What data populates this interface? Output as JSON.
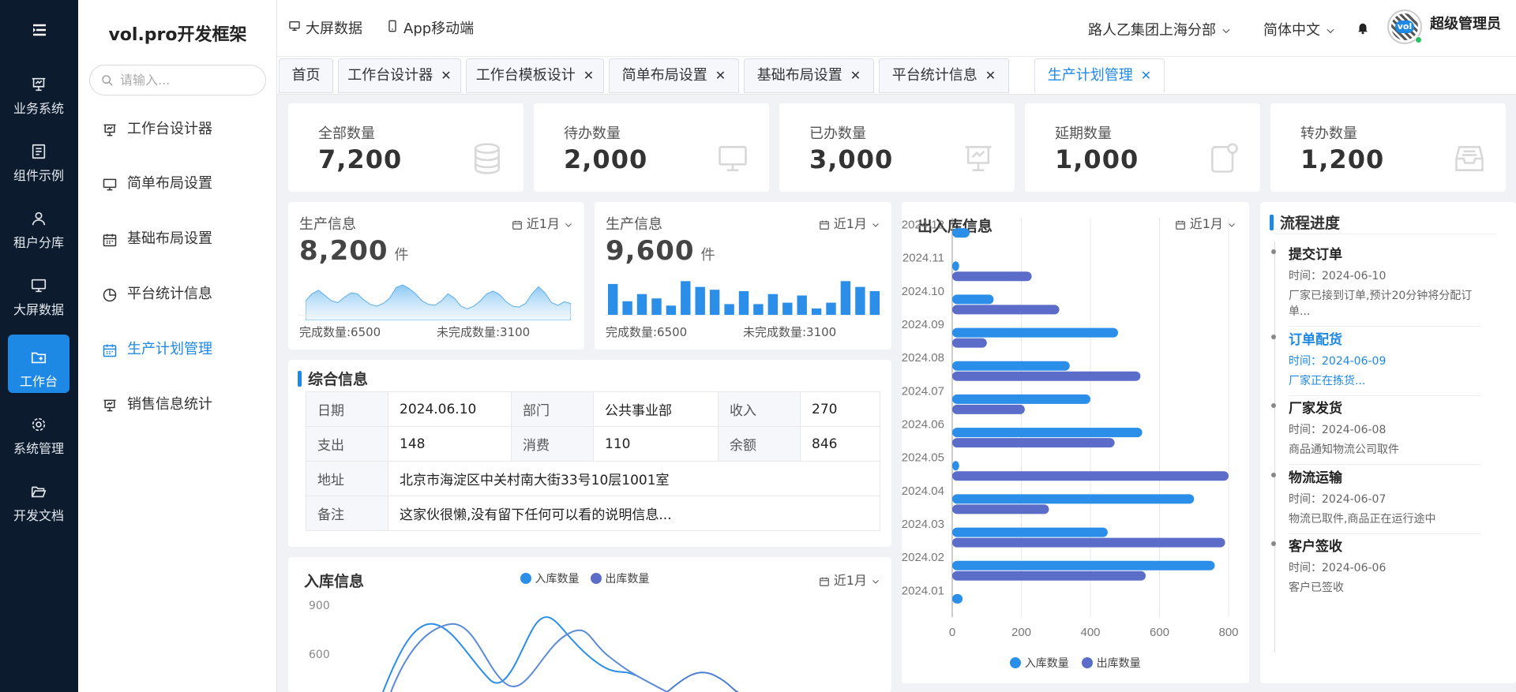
{
  "app": {
    "title": "vol.pro开发框架"
  },
  "rail": {
    "items": [
      {
        "label": "业务系统",
        "icon": "presentation-icon"
      },
      {
        "label": "组件示例",
        "icon": "document-icon"
      },
      {
        "label": "租户分库",
        "icon": "user-icon"
      },
      {
        "label": "大屏数据",
        "icon": "monitor-icon"
      },
      {
        "label": "工作台",
        "icon": "folder-plus-icon",
        "active": true
      },
      {
        "label": "系统管理",
        "icon": "gear-icon"
      },
      {
        "label": "开发文档",
        "icon": "folder-open-icon"
      }
    ]
  },
  "sidebar": {
    "search_placeholder": "请输入...",
    "items": [
      {
        "label": "工作台设计器",
        "icon": "presentation-icon"
      },
      {
        "label": "简单布局设置",
        "icon": "monitor-icon"
      },
      {
        "label": "基础布局设置",
        "icon": "calendar-icon"
      },
      {
        "label": "平台统计信息",
        "icon": "pie-chart-icon"
      },
      {
        "label": "生产计划管理",
        "icon": "calendar-icon",
        "active": true
      },
      {
        "label": "销售信息统计",
        "icon": "presentation-icon"
      }
    ]
  },
  "header": {
    "links": [
      {
        "label": "大屏数据",
        "icon": "monitor-icon"
      },
      {
        "label": "App移动端",
        "icon": "mobile-icon"
      }
    ],
    "org": "路人乙集团上海分部",
    "language": "简体中文",
    "user": "超级管理员",
    "avatar_text": "vol"
  },
  "tabs": [
    {
      "label": "首页"
    },
    {
      "label": "工作台设计器"
    },
    {
      "label": "工作台模板设计"
    },
    {
      "label": "简单布局设置"
    },
    {
      "label": "基础布局设置"
    },
    {
      "label": "平台统计信息"
    },
    {
      "label": "生产计划管理",
      "active": true
    }
  ],
  "close_glyph": "✕",
  "stats": [
    {
      "label": "全部数量",
      "value": "7,200",
      "icon": "database-icon"
    },
    {
      "label": "待办数量",
      "value": "2,000",
      "icon": "monitor-icon"
    },
    {
      "label": "已办数量",
      "value": "3,000",
      "icon": "presentation-icon"
    },
    {
      "label": "延期数量",
      "value": "1,000",
      "icon": "document-badge-icon"
    },
    {
      "label": "转办数量",
      "value": "1,200",
      "icon": "inbox-icon"
    }
  ],
  "production": [
    {
      "title": "生产信息",
      "value": "8,200",
      "unit": "件",
      "range": "近1月",
      "done": "完成数量:6500",
      "undone": "未完成数量:3100",
      "series": [
        22,
        30,
        34,
        28,
        22,
        20,
        26,
        31,
        30,
        23,
        18,
        16,
        19,
        25,
        37,
        40,
        36,
        30,
        22,
        18,
        17,
        22,
        30,
        25,
        16,
        13,
        16,
        22,
        30,
        33,
        29,
        21,
        16,
        15,
        19,
        30,
        38,
        31,
        20,
        17,
        21,
        19
      ]
    },
    {
      "title": "生产信息",
      "value": "9,600",
      "unit": "件",
      "range": "近1月",
      "done": "完成数量:6500",
      "undone": "未完成数量:3100",
      "bars": [
        22,
        10,
        15,
        12,
        7,
        24,
        20,
        18,
        8,
        17,
        8,
        15,
        9,
        14,
        5,
        9,
        24,
        20,
        17
      ]
    }
  ],
  "summary": {
    "title": "综合信息",
    "rows": [
      [
        {
          "k": "日期",
          "v": "2024.06.10"
        },
        {
          "k": "部门",
          "v": "公共事业部"
        },
        {
          "k": "收入",
          "v": "270"
        }
      ],
      [
        {
          "k": "支出",
          "v": "148"
        },
        {
          "k": "消费",
          "v": "110"
        },
        {
          "k": "余额",
          "v": "846"
        }
      ],
      [
        {
          "k": "地址",
          "v": "北京市海淀区中关村南大街33号10层1001室"
        }
      ],
      [
        {
          "k": "备注",
          "v": "这家伙很懒,没有留下任何可以看的说明信息..."
        }
      ]
    ]
  },
  "inbound": {
    "title": "入库信息",
    "range": "近1月",
    "legend": [
      "入库数量",
      "出库数量"
    ],
    "yticks": [
      "900",
      "600"
    ]
  },
  "chart_data": {
    "type": "bar",
    "title": "出入库信息",
    "range_label": "近1月",
    "orientation": "horizontal",
    "categories": [
      "2024.01",
      "2024.02",
      "2024.03",
      "2024.04",
      "2024.05",
      "2024.06",
      "2024.07",
      "2024.08",
      "2024.09",
      "2024.10",
      "2024.11",
      "2024.12"
    ],
    "series": [
      {
        "name": "入库数量",
        "color": "#2b8ee8",
        "values": [
          30,
          760,
          450,
          700,
          20,
          550,
          400,
          340,
          480,
          120,
          20,
          50
        ]
      },
      {
        "name": "出库数量",
        "color": "#5b6cc9",
        "values": [
          0,
          560,
          790,
          280,
          800,
          470,
          210,
          545,
          100,
          310,
          230,
          0
        ]
      }
    ],
    "xlim": [
      0,
      800
    ],
    "xticks": [
      "0",
      "200",
      "400",
      "600",
      "800"
    ],
    "legend_position": "bottom",
    "grid": true
  },
  "progress": {
    "title": "流程进度",
    "steps": [
      {
        "title": "提交订单",
        "time": "时间：2024-06-10",
        "desc": "厂家已接到订单,预计20分钟将分配订单..."
      },
      {
        "title": "订单配货",
        "time": "时间：2024-06-09",
        "desc": "厂家正在拣货...",
        "active": true
      },
      {
        "title": "厂家发货",
        "time": "时间：2024-06-08",
        "desc": "商品通知物流公司取件"
      },
      {
        "title": "物流运输",
        "time": "时间：2024-06-07",
        "desc": "物流已取件,商品正在运行途中"
      },
      {
        "title": "客户签收",
        "time": "时间：2024-06-06",
        "desc": "客户已签收"
      }
    ]
  }
}
